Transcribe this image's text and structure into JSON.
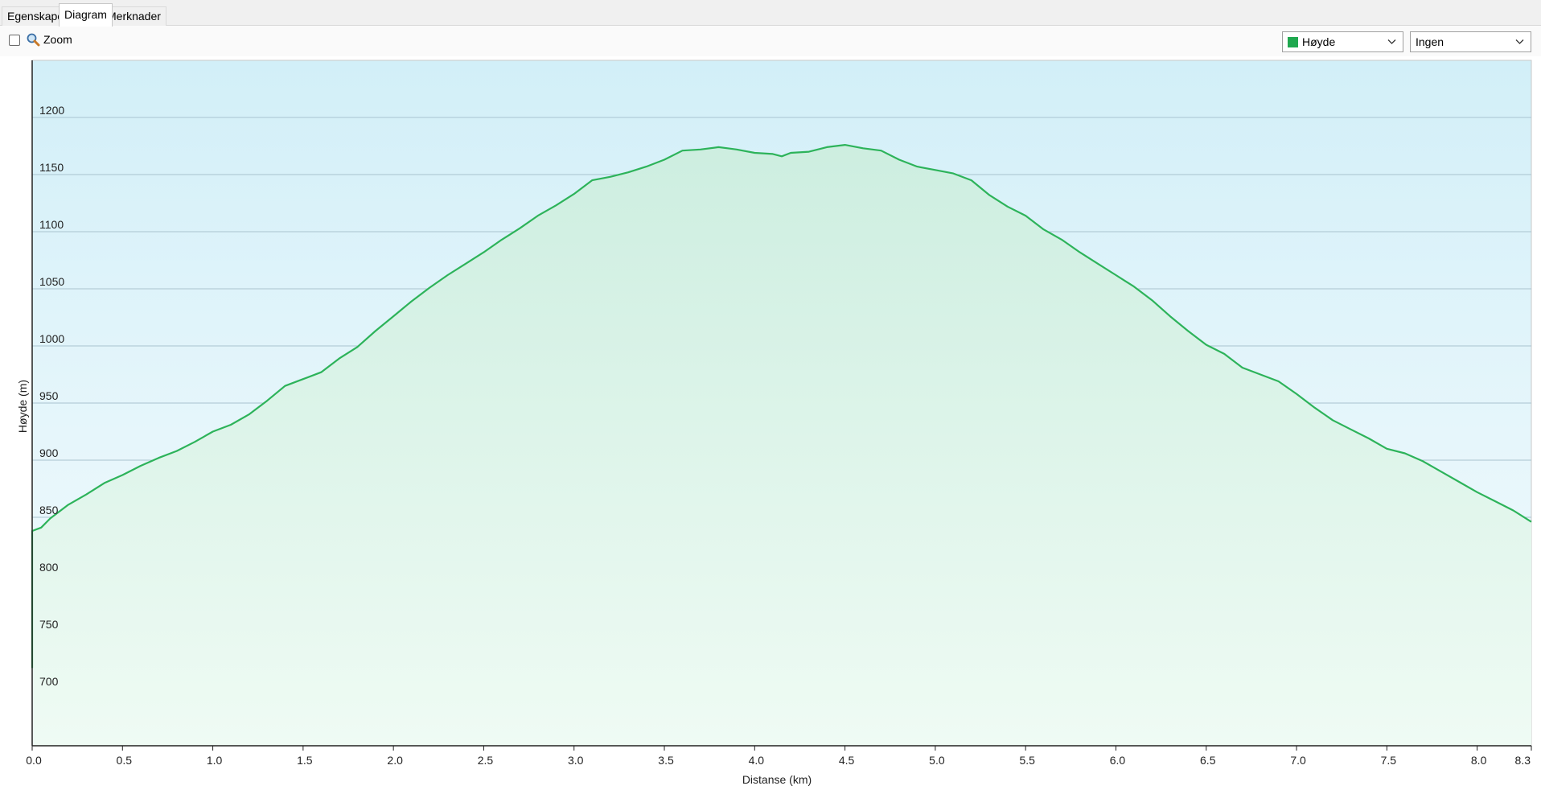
{
  "tabs": [
    {
      "label": "Egenskaper",
      "active": false
    },
    {
      "label": "Diagram",
      "active": true
    },
    {
      "label": "Merknader",
      "active": false
    }
  ],
  "toolbar": {
    "zoom_label": "Zoom",
    "zoom_checked": false,
    "series_dropdown": {
      "value": "Høyde",
      "color": "#1fa84f"
    },
    "compare_dropdown": {
      "value": "Ingen"
    }
  },
  "chart_data": {
    "type": "area",
    "xlabel": "Distanse  (km)",
    "ylabel": "Høyde (m)",
    "xlim": [
      0,
      8.3
    ],
    "ylim": [
      650,
      1250
    ],
    "x_ticks": [
      "0.0",
      "0.5",
      "1.0",
      "1.5",
      "2.0",
      "2.5",
      "3.0",
      "3.5",
      "4.0",
      "4.5",
      "5.0",
      "5.5",
      "6.0",
      "6.5",
      "7.0",
      "7.5",
      "8.0",
      "8.3"
    ],
    "x_tick_values": [
      0,
      0.5,
      1.0,
      1.5,
      2.0,
      2.5,
      3.0,
      3.5,
      4.0,
      4.5,
      5.0,
      5.5,
      6.0,
      6.5,
      7.0,
      7.5,
      8.0,
      8.3
    ],
    "y_ticks": [
      700,
      750,
      800,
      850,
      900,
      950,
      1000,
      1050,
      1100,
      1150,
      1200
    ],
    "grid": true,
    "line_color": "#2db35a",
    "series": [
      {
        "x": [
          0.0,
          0.0,
          0.05,
          0.1,
          0.2,
          0.3,
          0.4,
          0.5,
          0.6,
          0.7,
          0.8,
          0.9,
          1.0,
          1.1,
          1.2,
          1.3,
          1.4,
          1.5,
          1.6,
          1.7,
          1.8,
          1.9,
          2.0,
          2.1,
          2.2,
          2.3,
          2.4,
          2.5,
          2.6,
          2.7,
          2.8,
          2.9,
          3.0,
          3.1,
          3.2,
          3.3,
          3.4,
          3.5,
          3.6,
          3.7,
          3.8,
          3.85,
          3.9,
          4.0,
          4.1,
          4.15,
          4.2,
          4.3,
          4.4,
          4.5,
          4.6,
          4.7,
          4.8,
          4.9,
          5.0,
          5.1,
          5.2,
          5.3,
          5.4,
          5.5,
          5.6,
          5.7,
          5.8,
          5.9,
          6.0,
          6.1,
          6.2,
          6.3,
          6.4,
          6.5,
          6.6,
          6.7,
          6.8,
          6.9,
          7.0,
          7.1,
          7.2,
          7.3,
          7.4,
          7.5,
          7.6,
          7.7,
          7.8,
          7.9,
          8.0,
          8.1,
          8.2,
          8.3
        ],
        "y": [
          718,
          838,
          841,
          849,
          861,
          870,
          880,
          887,
          895,
          902,
          908,
          916,
          925,
          931,
          940,
          952,
          965,
          971,
          977,
          989,
          999,
          1013,
          1026,
          1039,
          1051,
          1062,
          1072,
          1082,
          1093,
          1103,
          1114,
          1123,
          1133,
          1145,
          1148,
          1152,
          1157,
          1163,
          1171,
          1172,
          1174,
          1173,
          1172,
          1169,
          1168,
          1166,
          1169,
          1170,
          1174,
          1176,
          1173,
          1171,
          1163,
          1157,
          1154,
          1151,
          1145,
          1132,
          1122,
          1114,
          1102,
          1093,
          1082,
          1072,
          1062,
          1052,
          1040,
          1026,
          1013,
          1001,
          993,
          981,
          975,
          969,
          958,
          946,
          935,
          927,
          919,
          910,
          906,
          899,
          890,
          881,
          872,
          864,
          856,
          846
        ]
      }
    ]
  }
}
